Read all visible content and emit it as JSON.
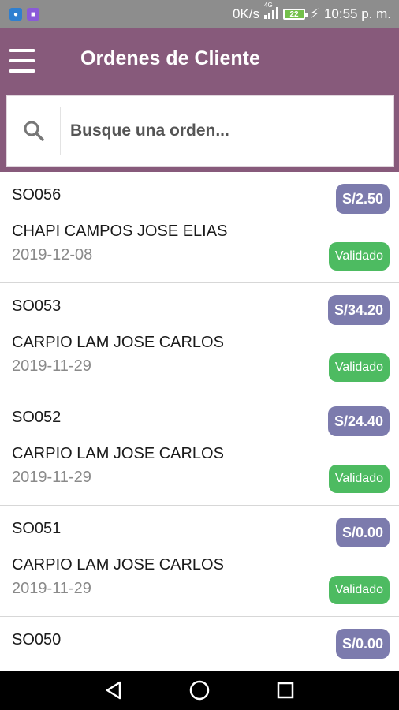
{
  "status_bar": {
    "speed": "0K/s",
    "network": "4G",
    "battery": "22",
    "time": "10:55 p. m."
  },
  "app_bar": {
    "title": "Ordenes de Cliente"
  },
  "search": {
    "placeholder": "Busque una orden..."
  },
  "orders": [
    {
      "ref": "SO056",
      "customer": "CHAPI CAMPOS JOSE ELIAS",
      "date": "2019-12-08",
      "amount": "S/2.50",
      "status": "Validado"
    },
    {
      "ref": "SO053",
      "customer": "CARPIO LAM JOSE CARLOS",
      "date": "2019-11-29",
      "amount": "S/34.20",
      "status": "Validado"
    },
    {
      "ref": "SO052",
      "customer": "CARPIO LAM JOSE CARLOS",
      "date": "2019-11-29",
      "amount": "S/24.40",
      "status": "Validado"
    },
    {
      "ref": "SO051",
      "customer": "CARPIO LAM JOSE CARLOS",
      "date": "2019-11-29",
      "amount": "S/0.00",
      "status": "Validado"
    },
    {
      "ref": "SO050",
      "amount": "S/0.00"
    }
  ],
  "colors": {
    "app_bar": "#875a7b",
    "amount_badge": "#7c7bad",
    "status_badge": "#4dbb61"
  },
  "icons": {
    "menu": "hamburger-icon",
    "search": "search-icon",
    "nav_back": "back-triangle-icon",
    "nav_home": "home-circle-icon",
    "nav_recent": "recent-square-icon"
  }
}
